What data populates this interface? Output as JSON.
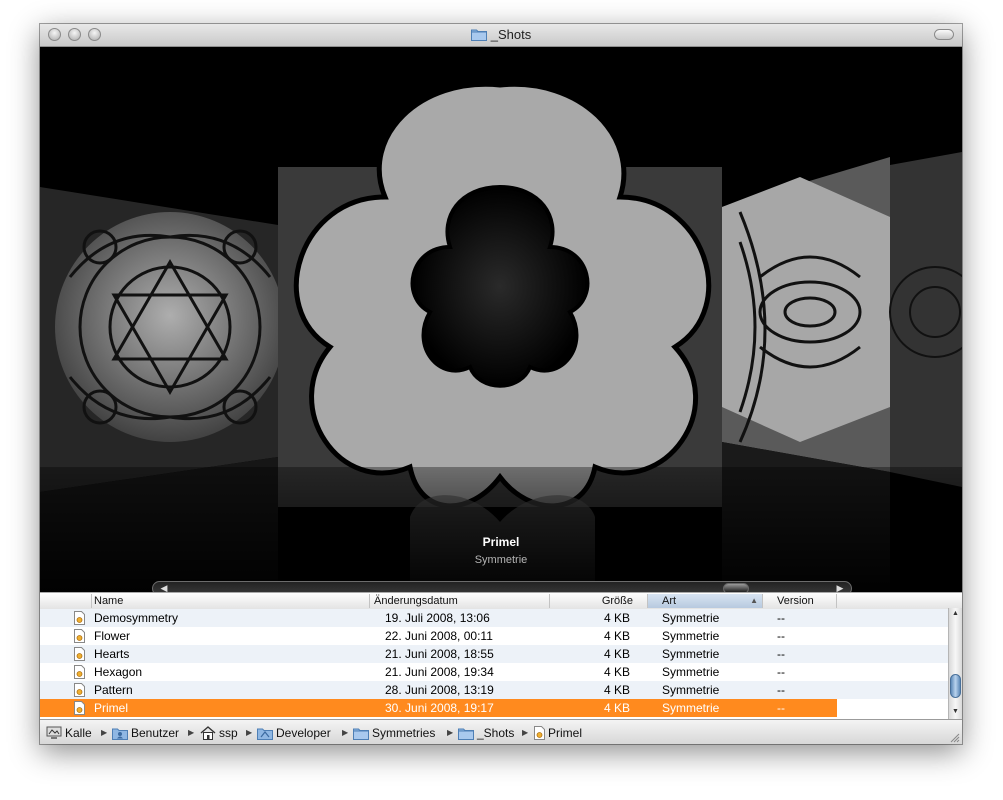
{
  "window": {
    "title": "_Shots"
  },
  "coverflow": {
    "item_title": "Primel",
    "item_subtitle": "Symmetrie"
  },
  "columns": {
    "name": "Name",
    "date": "Änderungsdatum",
    "size": "Größe",
    "kind": "Art",
    "version": "Version"
  },
  "rows": [
    {
      "name": "Demosymmetry",
      "date": "19. Juli 2008, 13:06",
      "size": "4 KB",
      "kind": "Symmetrie",
      "version": "--"
    },
    {
      "name": "Flower",
      "date": "22. Juni 2008, 00:11",
      "size": "4 KB",
      "kind": "Symmetrie",
      "version": "--"
    },
    {
      "name": "Hearts",
      "date": "21. Juni 2008, 18:55",
      "size": "4 KB",
      "kind": "Symmetrie",
      "version": "--"
    },
    {
      "name": "Hexagon",
      "date": "21. Juni 2008, 19:34",
      "size": "4 KB",
      "kind": "Symmetrie",
      "version": "--"
    },
    {
      "name": "Pattern",
      "date": "28. Juni 2008, 13:19",
      "size": "4 KB",
      "kind": "Symmetrie",
      "version": "--"
    },
    {
      "name": "Primel",
      "date": "30. Juni 2008, 19:17",
      "size": "4 KB",
      "kind": "Symmetrie",
      "version": "--"
    }
  ],
  "path": [
    "Kalle",
    "Benutzer",
    "ssp",
    "Developer",
    "Symmetries",
    "_Shots",
    "Primel"
  ],
  "icons": {
    "computer": "computer-icon",
    "users_folder": "users-folder-icon",
    "home": "home-icon",
    "developer": "developer-folder-icon",
    "folder": "folder-icon",
    "document": "symmetry-document-icon"
  },
  "colors": {
    "selection": "#ff8a1e",
    "alt_row": "#edf2f8",
    "coverflow_bg": "#000000"
  }
}
